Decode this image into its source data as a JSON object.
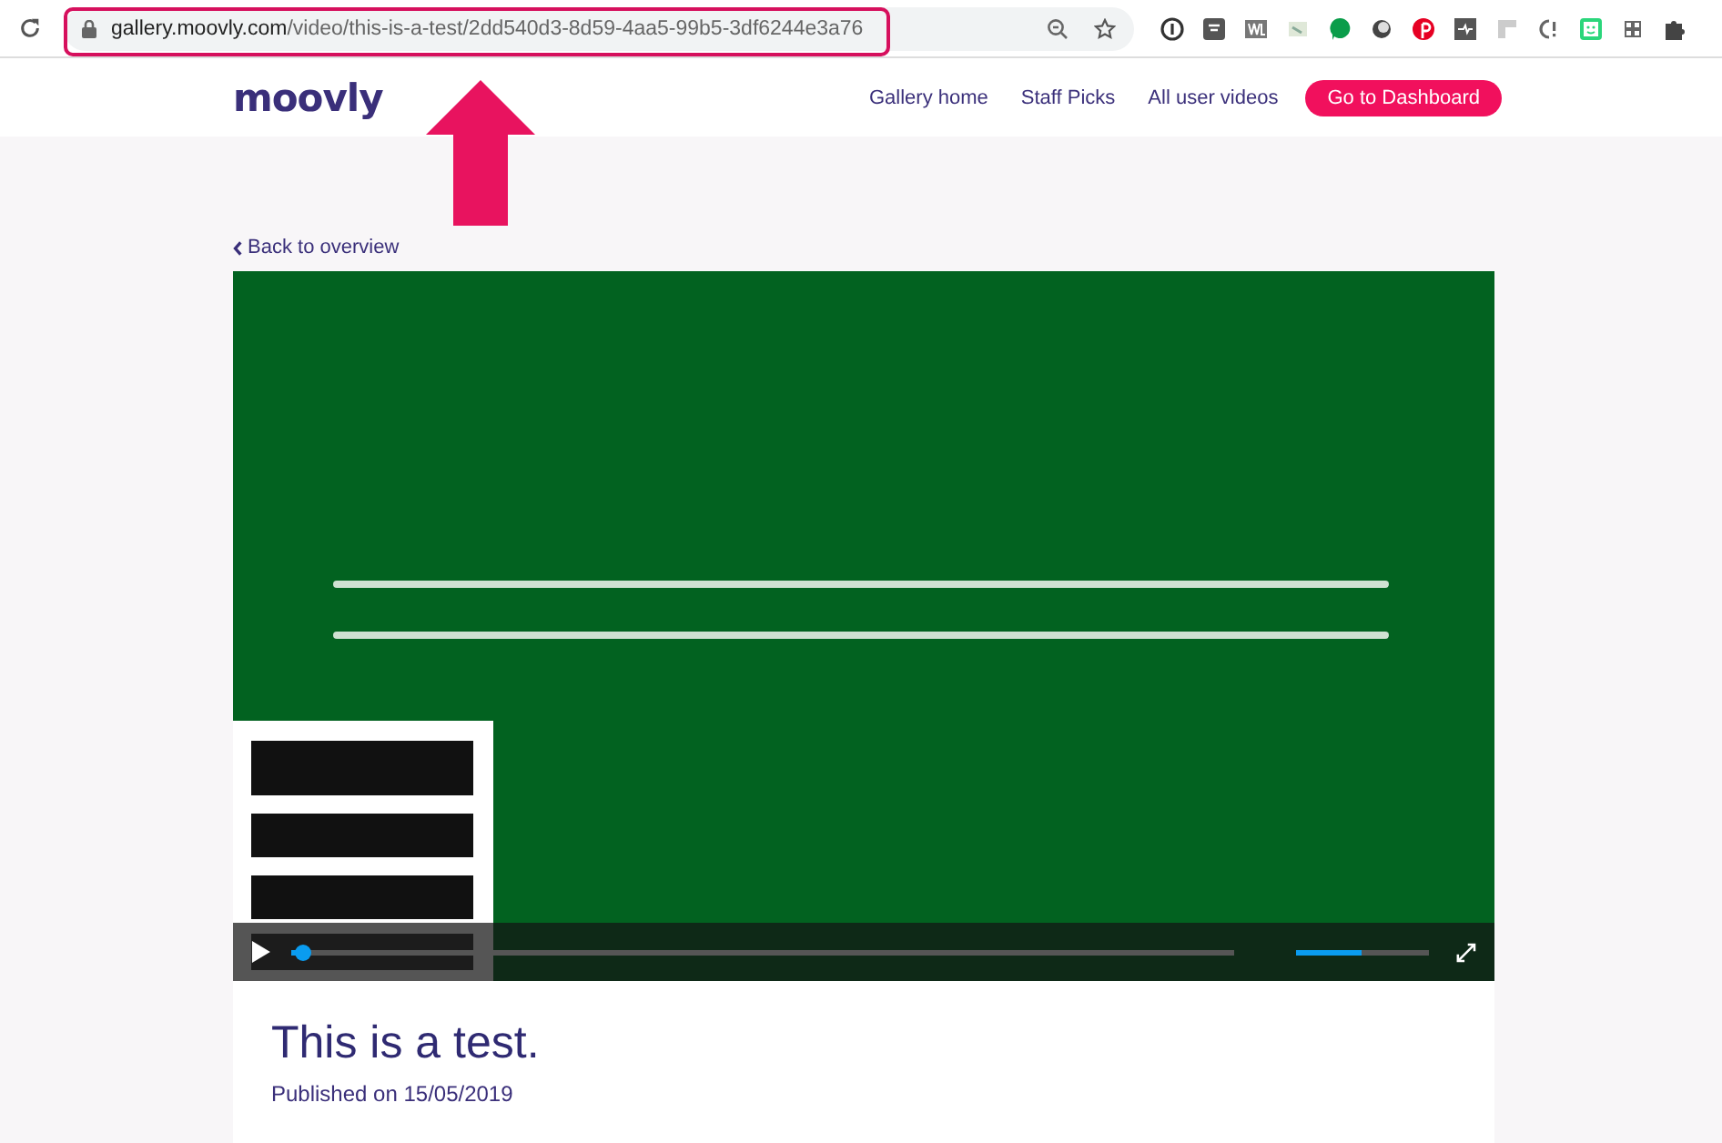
{
  "browser": {
    "url": {
      "host": "gallery.moovly.com",
      "path": "/video/this-is-a-test/2dd540d3-8d59-4aa5-99b5-3df6244e3a76"
    }
  },
  "header": {
    "logo": "moovly",
    "nav": [
      "Gallery home",
      "Staff Picks",
      "All user videos"
    ],
    "cta": "Go to Dashboard"
  },
  "back_link": "Back to overview",
  "video": {
    "kind": "picture",
    "progress": {
      "level": 0.012
    },
    "volume": {
      "level": 0.5
    }
  },
  "title": "This is a test.",
  "published": "Published on 15/05/2019"
}
